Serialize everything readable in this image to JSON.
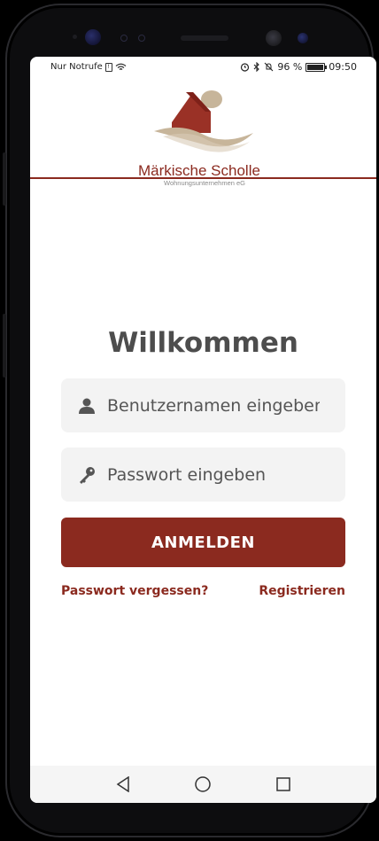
{
  "status_bar": {
    "carrier": "Nur Notrufe",
    "battery_percent": "96 %",
    "time": "09:50",
    "battery_level": 0.96
  },
  "brand": {
    "name": "Märkische Scholle",
    "subtitle": "Wohnungsunternehmen eG",
    "color": "#8b2a1f"
  },
  "login": {
    "title": "Willkommen",
    "username_placeholder": "Benutzernamen eingeben",
    "username_value": "",
    "password_placeholder": "Passwort eingeben",
    "password_value": "",
    "submit_label": "ANMELDEN",
    "forgot_link": "Passwort vergessen?",
    "register_link": "Registrieren"
  },
  "icons": {
    "username": "user-icon",
    "password": "key-icon",
    "nav_back": "back-triangle-icon",
    "nav_home": "home-circle-icon",
    "nav_recents": "recents-square-icon"
  }
}
